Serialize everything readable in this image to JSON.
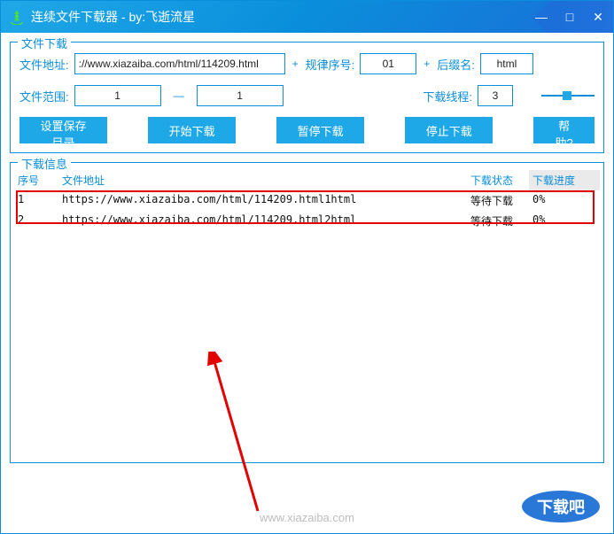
{
  "window": {
    "title": "连续文件下载器 - by:飞逝流星"
  },
  "download": {
    "legend": "文件下载",
    "url_label": "文件地址:",
    "url_value": "://www.xiazaiba.com/html/114209.html",
    "rule_label": "规律序号:",
    "rule_value": "01",
    "suffix_label": "后缀名:",
    "suffix_value": "html",
    "range_label": "文件范围:",
    "range_from": "1",
    "range_dash": "—",
    "range_to": "1",
    "thread_label": "下载线程:",
    "thread_value": "3",
    "plus1": "+",
    "plus2": "+",
    "buttons": {
      "set_dir": "设置保存目录",
      "start": "开始下载",
      "pause": "暂停下载",
      "stop": "停止下载",
      "help": "帮助?"
    }
  },
  "info": {
    "legend": "下载信息",
    "headers": {
      "idx": "序号",
      "url": "文件地址",
      "status": "下载状态",
      "progress": "下载进度"
    },
    "rows": [
      {
        "idx": "1",
        "url": "https://www.xiazaiba.com/html/114209.html1html",
        "status": "等待下载",
        "progress": "0%"
      },
      {
        "idx": "2",
        "url": "https://www.xiazaiba.com/html/114209.html2html",
        "status": "等待下载",
        "progress": "0%"
      }
    ]
  },
  "watermark": "www.xiazaiba.com",
  "logo_text": "下载吧"
}
